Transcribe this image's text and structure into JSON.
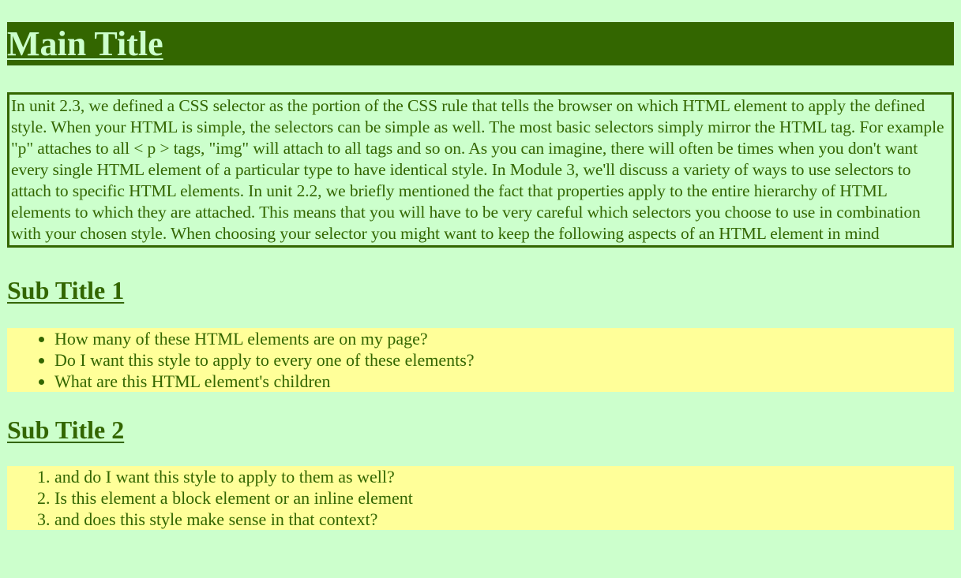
{
  "main_title": "Main Title",
  "intro_text": "In unit 2.3, we defined a CSS selector as the portion of the CSS rule that tells the browser on which HTML element to apply the defined style. When your HTML is simple, the selectors can be simple as well. The most basic selectors simply mirror the HTML tag. For example \"p\" attaches to all < p > tags, \"img\" will attach to all  tags and so on. As you can imagine, there will often be times when you don't want every single HTML element of a particular type to have identical style. In Module 3, we'll discuss a variety of ways to use selectors to attach to specific HTML elements. In unit 2.2, we briefly mentioned the fact that properties apply to the entire hierarchy of HTML elements to which they are attached. This means that you will have to be very careful which selectors you choose to use in combination with your chosen style. When choosing your selector you might want to keep the following aspects of an HTML element in mind",
  "section1": {
    "title": "Sub Title 1",
    "items": [
      "How many of these HTML elements are on my page?",
      "Do I want this style to apply to every one of these elements?",
      "What are this HTML element's children"
    ]
  },
  "section2": {
    "title": "Sub Title 2",
    "items": [
      "and do I want this style to apply to them as well?",
      "Is this element a block element or an inline element",
      "and does this style make sense in that context?"
    ]
  },
  "colors": {
    "page_background": "#ccffcc",
    "text": "#336600",
    "title_background": "#336600",
    "title_text": "#ccffcc",
    "list_background": "#ffff99"
  }
}
